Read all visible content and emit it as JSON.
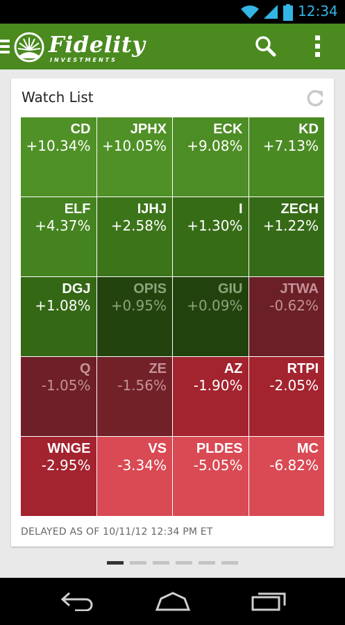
{
  "status_bar": {
    "time": "12:34"
  },
  "app": {
    "logo_text": "Fidelity",
    "logo_sub": "INVESTMENTS",
    "brand_color": "#4a8a1f"
  },
  "watchlist": {
    "title": "Watch List",
    "delayed_note": "DELAYED AS OF 10/11/12 12:34 PM ET",
    "tiles": [
      {
        "symbol": "CD",
        "change": "+10.34%",
        "bg": "#4f9126",
        "fg": "#ffffff"
      },
      {
        "symbol": "JPHX",
        "change": "+10.05%",
        "bg": "#4f9126",
        "fg": "#ffffff"
      },
      {
        "symbol": "ECK",
        "change": "+9.08%",
        "bg": "#4d8d25",
        "fg": "#ffffff"
      },
      {
        "symbol": "KD",
        "change": "+7.13%",
        "bg": "#4a8a23",
        "fg": "#ffffff"
      },
      {
        "symbol": "ELF",
        "change": "+4.37%",
        "bg": "#458320",
        "fg": "#ffffff"
      },
      {
        "symbol": "IJHJ",
        "change": "+2.58%",
        "bg": "#3b7419",
        "fg": "#ffffff"
      },
      {
        "symbol": "I",
        "change": "+1.30%",
        "bg": "#376c17",
        "fg": "#ffffff"
      },
      {
        "symbol": "ZECH",
        "change": "+1.22%",
        "bg": "#356a16",
        "fg": "#ffffff"
      },
      {
        "symbol": "DGJ",
        "change": "+1.08%",
        "bg": "#346815",
        "fg": "#ffffff"
      },
      {
        "symbol": "OPIS",
        "change": "+0.95%",
        "bg": "#23430e",
        "fg": "#8aa57c"
      },
      {
        "symbol": "GIU",
        "change": "+0.09%",
        "bg": "#22420d",
        "fg": "#8aa57c"
      },
      {
        "symbol": "JTWA",
        "change": "-0.62%",
        "bg": "#6b1f26",
        "fg": "#c49297"
      },
      {
        "symbol": "Q",
        "change": "-1.05%",
        "bg": "#6e1f27",
        "fg": "#c49297"
      },
      {
        "symbol": "ZE",
        "change": "-1.56%",
        "bg": "#722129",
        "fg": "#c49297"
      },
      {
        "symbol": "AZ",
        "change": "-1.90%",
        "bg": "#a3232f",
        "fg": "#ffffff"
      },
      {
        "symbol": "RTPI",
        "change": "-2.05%",
        "bg": "#a3232f",
        "fg": "#ffffff"
      },
      {
        "symbol": "WNGE",
        "change": "-2.95%",
        "bg": "#a3232f",
        "fg": "#ffffff"
      },
      {
        "symbol": "VS",
        "change": "-3.34%",
        "bg": "#d94a54",
        "fg": "#ffffff"
      },
      {
        "symbol": "PLDES",
        "change": "-5.05%",
        "bg": "#d94a54",
        "fg": "#ffffff"
      },
      {
        "symbol": "MC",
        "change": "-6.82%",
        "bg": "#d94a54",
        "fg": "#ffffff"
      }
    ]
  },
  "pager": {
    "count": 6,
    "active_index": 0
  },
  "icons": {
    "menu": "menu-icon",
    "search": "search-icon",
    "overflow": "overflow-menu-icon",
    "refresh": "refresh-icon",
    "back": "back-icon",
    "home": "home-icon",
    "recents": "recents-icon",
    "wifi": "wifi-icon",
    "signal": "signal-icon",
    "battery": "battery-icon"
  }
}
